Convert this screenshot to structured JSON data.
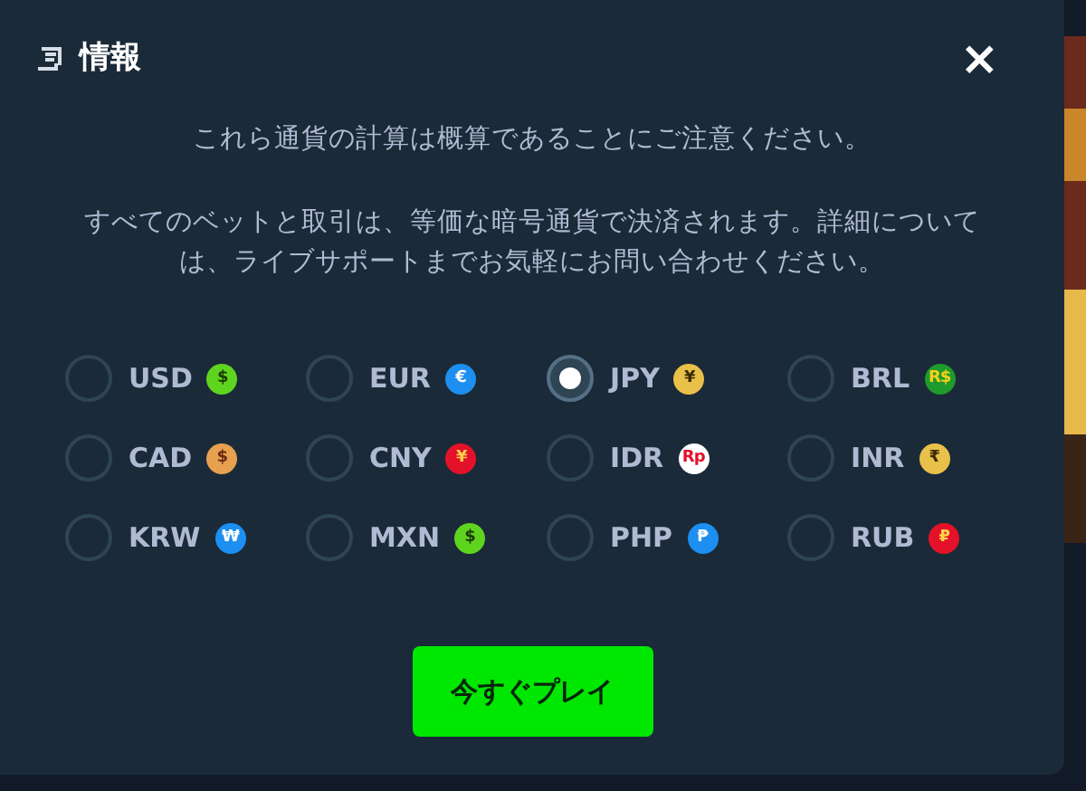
{
  "dialog": {
    "title": "情報",
    "close": "×"
  },
  "notes": [
    "これら通貨の計算は概算であることにご注意ください。",
    "すべてのベットと取引は、等価な暗号通貨で決済されます。詳細については、ライブサポートまでお気軽にお問い合わせください。"
  ],
  "currencies": [
    {
      "code": "USD",
      "symbol": "$",
      "color": "#5fd41f",
      "selected": false
    },
    {
      "code": "EUR",
      "symbol": "€",
      "color": "#1d8ff0",
      "selected": false
    },
    {
      "code": "JPY",
      "symbol": "¥",
      "color": "#e9c14a",
      "selected": true
    },
    {
      "code": "BRL",
      "symbol": "R$",
      "color": "#1f9a2c",
      "selected": false
    },
    {
      "code": "CAD",
      "symbol": "$",
      "color": "#e6a04f",
      "selected": false
    },
    {
      "code": "CNY",
      "symbol": "¥",
      "color": "#e3122a",
      "selected": false
    },
    {
      "code": "IDR",
      "symbol": "Rp",
      "color": "#ffffff",
      "selected": false
    },
    {
      "code": "INR",
      "symbol": "₹",
      "color": "#e9c14a",
      "selected": false
    },
    {
      "code": "KRW",
      "symbol": "₩",
      "color": "#1d8ff0",
      "selected": false
    },
    {
      "code": "MXN",
      "symbol": "$",
      "color": "#5fd41f",
      "selected": false
    },
    {
      "code": "PHP",
      "symbol": "₱",
      "color": "#1d8ff0",
      "selected": false
    },
    {
      "code": "RUB",
      "symbol": "₽",
      "color": "#e3122a",
      "selected": false
    }
  ],
  "play_button": "今すぐプレイ"
}
